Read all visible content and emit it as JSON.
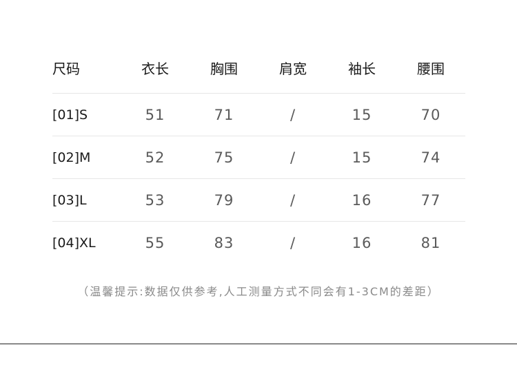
{
  "table": {
    "headers": [
      "尺码",
      "衣长",
      "胸围",
      "肩宽",
      "袖长",
      "腰围"
    ],
    "rows": [
      [
        "[01]S",
        "51",
        "71",
        "/",
        "15",
        "70"
      ],
      [
        "[02]M",
        "52",
        "75",
        "/",
        "15",
        "74"
      ],
      [
        "[03]L",
        "53",
        "79",
        "/",
        "16",
        "77"
      ],
      [
        "[04]XL",
        "55",
        "83",
        "/",
        "16",
        "81"
      ]
    ]
  },
  "note": "（温馨提示:数据仅供参考,人工测量方式不同会有1-3CM的差距）"
}
